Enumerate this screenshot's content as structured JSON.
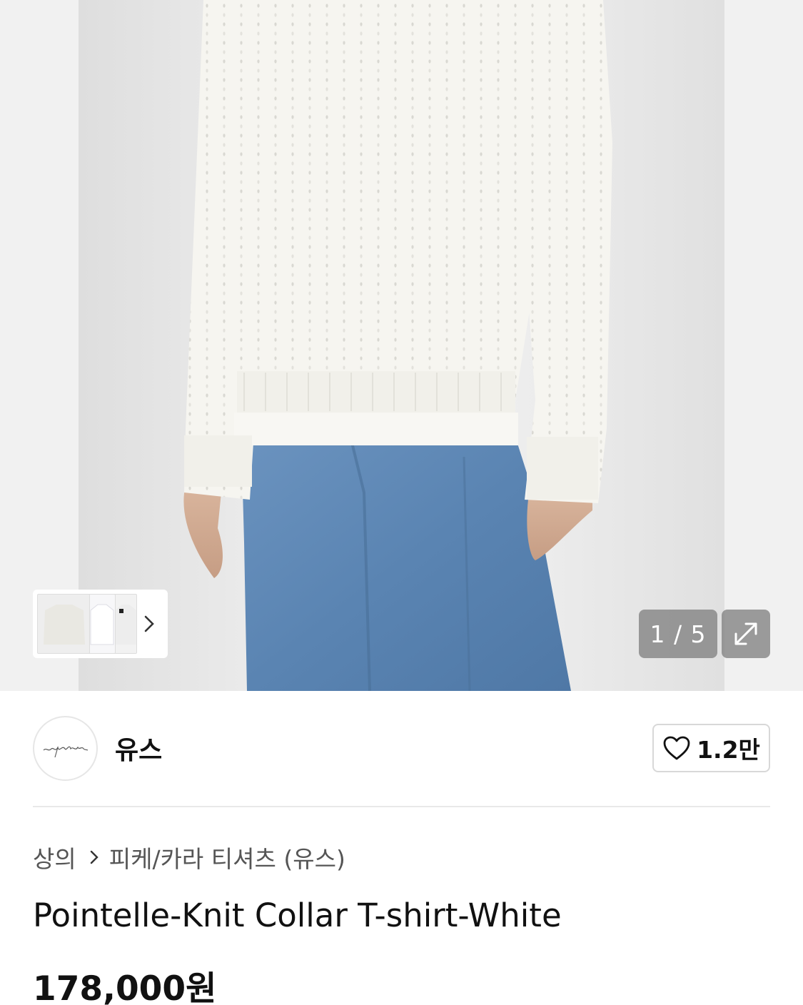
{
  "gallery": {
    "counter": "1 / 5",
    "icons": {
      "next": "chevron-right-icon",
      "expand": "expand-icon"
    }
  },
  "brand": {
    "logo_text": "~youth.",
    "name": "유스",
    "likes": "1.2만",
    "like_icon": "heart-outline-icon"
  },
  "breadcrumb": {
    "category": "상의",
    "subcategory": "피케/카라 티셔츠 (유스)",
    "separator_icon": "chevron-right-icon"
  },
  "product": {
    "title": "Pointelle-Knit Collar T-shirt-White",
    "price": "178,000원"
  },
  "colors": {
    "text": "#111111",
    "muted": "#555555",
    "divider": "#e8e8e8",
    "overlay": "#787878",
    "denim": "#5d86b4",
    "knit": "#f6f5f0"
  }
}
